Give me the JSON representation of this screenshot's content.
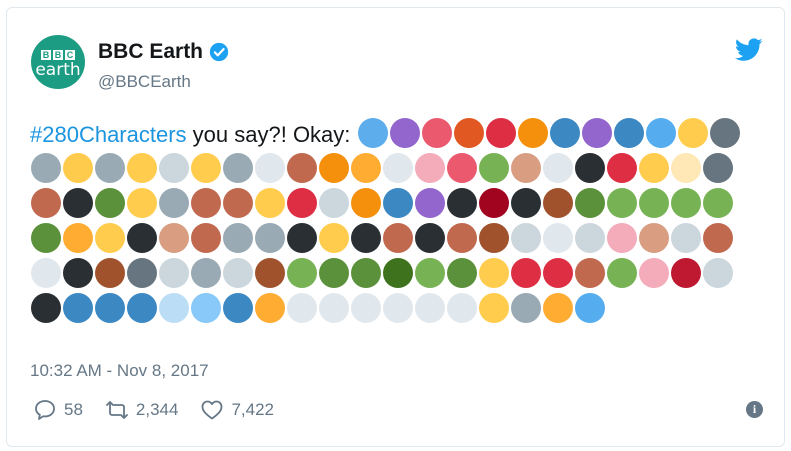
{
  "author": {
    "display_name": "BBC Earth",
    "handle": "@BBCEarth",
    "avatar": {
      "logo_letters": [
        "B",
        "B",
        "C"
      ],
      "logo_word": "earth",
      "color": "#1d9c84"
    },
    "verified_icon": "verified-badge-icon"
  },
  "platform_icon": "twitter-bird-icon",
  "tweet": {
    "hashtag": "#280Characters",
    "text": " you say?! Okay: ",
    "emojis": [
      {
        "name": "blue-heart",
        "color": "#5dadec"
      },
      {
        "name": "octopus",
        "color": "#9266cc"
      },
      {
        "name": "squid",
        "color": "#ea596e"
      },
      {
        "name": "shrimp",
        "color": "#e25822"
      },
      {
        "name": "crab",
        "color": "#dd2e44"
      },
      {
        "name": "blowfish",
        "color": "#f4900c"
      },
      {
        "name": "whale",
        "color": "#3b88c3"
      },
      {
        "name": "spouting-whale",
        "color": "#9266cc"
      },
      {
        "name": "dolphin",
        "color": "#3b88c3"
      },
      {
        "name": "fish",
        "color": "#55acee"
      },
      {
        "name": "tropical-fish",
        "color": "#ffcc4d"
      },
      {
        "name": "shark",
        "color": "#66757f"
      },
      {
        "name": "dog-face",
        "color": "#99aab5"
      },
      {
        "name": "cat-face",
        "color": "#ffcb4c"
      },
      {
        "name": "mouse-face",
        "color": "#99aab5"
      },
      {
        "name": "hamster-face",
        "color": "#ffcc4d"
      },
      {
        "name": "rabbit-face",
        "color": "#ccd6dd"
      },
      {
        "name": "tiger-face",
        "color": "#ffcc4d"
      },
      {
        "name": "koala",
        "color": "#99aab5"
      },
      {
        "name": "panda",
        "color": "#e1e8ed"
      },
      {
        "name": "bear",
        "color": "#c1694f"
      },
      {
        "name": "fox",
        "color": "#f4900c"
      },
      {
        "name": "lion",
        "color": "#ffac33"
      },
      {
        "name": "cow-face",
        "color": "#e1e8ed"
      },
      {
        "name": "pig-face",
        "color": "#f4abba"
      },
      {
        "name": "pig-nose",
        "color": "#ea596e"
      },
      {
        "name": "frog",
        "color": "#77b255"
      },
      {
        "name": "monkey-face",
        "color": "#d99e82"
      },
      {
        "name": "rooster",
        "color": "#e1e8ed"
      },
      {
        "name": "penguin",
        "color": "#292f33"
      },
      {
        "name": "bird",
        "color": "#dd2e44"
      },
      {
        "name": "baby-chick",
        "color": "#ffcc4d"
      },
      {
        "name": "hatching-chick",
        "color": "#ffe8b6"
      },
      {
        "name": "bat",
        "color": "#66757f"
      },
      {
        "name": "owl",
        "color": "#c1694f"
      },
      {
        "name": "eagle",
        "color": "#292f33"
      },
      {
        "name": "duck",
        "color": "#5c913b"
      },
      {
        "name": "front-chick",
        "color": "#ffcc4d"
      },
      {
        "name": "wolf",
        "color": "#99aab5"
      },
      {
        "name": "boar",
        "color": "#c1694f"
      },
      {
        "name": "horse-face",
        "color": "#c1694f"
      },
      {
        "name": "honeybee",
        "color": "#ffcc4d"
      },
      {
        "name": "lady-beetle",
        "color": "#dd2e44"
      },
      {
        "name": "shell",
        "color": "#ccd6dd"
      },
      {
        "name": "snail",
        "color": "#f4900c"
      },
      {
        "name": "butterfly",
        "color": "#3b88c3"
      },
      {
        "name": "caterpillar",
        "color": "#9266cc"
      },
      {
        "name": "ant",
        "color": "#292f33"
      },
      {
        "name": "cricket",
        "color": "#a0041e"
      },
      {
        "name": "spider",
        "color": "#292f33"
      },
      {
        "name": "scorpion",
        "color": "#a0522d"
      },
      {
        "name": "turtle",
        "color": "#5c913b"
      },
      {
        "name": "snake",
        "color": "#77b255"
      },
      {
        "name": "lizard",
        "color": "#77b255"
      },
      {
        "name": "t-rex",
        "color": "#77b255"
      },
      {
        "name": "sauropod",
        "color": "#77b255"
      },
      {
        "name": "crocodile",
        "color": "#5c913b"
      },
      {
        "name": "tiger",
        "color": "#ffac33"
      },
      {
        "name": "leopard",
        "color": "#ffcc4d"
      },
      {
        "name": "zebra",
        "color": "#292f33"
      },
      {
        "name": "dromedary",
        "color": "#d99e82"
      },
      {
        "name": "camel",
        "color": "#c1694f"
      },
      {
        "name": "rhinoceros",
        "color": "#99aab5"
      },
      {
        "name": "elephant",
        "color": "#99aab5"
      },
      {
        "name": "gorilla",
        "color": "#292f33"
      },
      {
        "name": "giraffe",
        "color": "#ffcc4d"
      },
      {
        "name": "water-buffalo",
        "color": "#292f33"
      },
      {
        "name": "ox",
        "color": "#c1694f"
      },
      {
        "name": "cow",
        "color": "#292f33"
      },
      {
        "name": "horse",
        "color": "#c1694f"
      },
      {
        "name": "deer",
        "color": "#a0522d"
      },
      {
        "name": "goat",
        "color": "#ccd6dd"
      },
      {
        "name": "ram",
        "color": "#e1e8ed"
      },
      {
        "name": "sheep",
        "color": "#ccd6dd"
      },
      {
        "name": "pig",
        "color": "#f4abba"
      },
      {
        "name": "dog",
        "color": "#d99e82"
      },
      {
        "name": "poodle",
        "color": "#ccd6dd"
      },
      {
        "name": "dog2",
        "color": "#c1694f"
      },
      {
        "name": "chicken",
        "color": "#e1e8ed"
      },
      {
        "name": "turkey",
        "color": "#292f33"
      },
      {
        "name": "chipmunk",
        "color": "#a0522d"
      },
      {
        "name": "rat",
        "color": "#66757f"
      },
      {
        "name": "mouse",
        "color": "#ccd6dd"
      },
      {
        "name": "rabbit",
        "color": "#99aab5"
      },
      {
        "name": "dove",
        "color": "#ccd6dd"
      },
      {
        "name": "hedgehog",
        "color": "#a0522d"
      },
      {
        "name": "seedling",
        "color": "#77b255"
      },
      {
        "name": "palm-tree",
        "color": "#5c913b"
      },
      {
        "name": "deciduous-tree",
        "color": "#5c913b"
      },
      {
        "name": "evergreen-tree",
        "color": "#3e721d"
      },
      {
        "name": "herb",
        "color": "#77b255"
      },
      {
        "name": "shamrock",
        "color": "#5c913b"
      },
      {
        "name": "sheaf-of-rice",
        "color": "#ffcc4d"
      },
      {
        "name": "mushroom",
        "color": "#dd2e44"
      },
      {
        "name": "maple-leaf",
        "color": "#dd2e44"
      },
      {
        "name": "fallen-leaf",
        "color": "#c1694f"
      },
      {
        "name": "leaf-fluttering",
        "color": "#77b255"
      },
      {
        "name": "tulip",
        "color": "#f4abba"
      },
      {
        "name": "rose",
        "color": "#be1931"
      },
      {
        "name": "full-moon-face",
        "color": "#ccd6dd"
      },
      {
        "name": "new-moon-face",
        "color": "#292f33"
      },
      {
        "name": "globe-africa",
        "color": "#3b88c3"
      },
      {
        "name": "globe-americas",
        "color": "#3b88c3"
      },
      {
        "name": "globe-asia",
        "color": "#3b88c3"
      },
      {
        "name": "wind",
        "color": "#bbddf5"
      },
      {
        "name": "snowflake",
        "color": "#88c9f9"
      },
      {
        "name": "water-wave",
        "color": "#3b88c3"
      },
      {
        "name": "sun",
        "color": "#ffac33"
      },
      {
        "name": "sun-rain-cloud",
        "color": "#e1e8ed"
      },
      {
        "name": "rain-cloud",
        "color": "#e1e8ed"
      },
      {
        "name": "lightning-cloud",
        "color": "#e1e8ed"
      },
      {
        "name": "rain-snow-cloud",
        "color": "#e1e8ed"
      },
      {
        "name": "snow-cloud",
        "color": "#e1e8ed"
      },
      {
        "name": "cloud",
        "color": "#e1e8ed"
      },
      {
        "name": "sun-behind-cloud",
        "color": "#ffcc4d"
      },
      {
        "name": "tornado",
        "color": "#99aab5"
      },
      {
        "name": "lightning",
        "color": "#ffac33"
      },
      {
        "name": "comet",
        "color": "#55acee"
      }
    ]
  },
  "timestamp": "10:32 AM - Nov 8, 2017",
  "actions": {
    "replies": "58",
    "retweets": "2,344",
    "likes": "7,422",
    "info_glyph": "i"
  },
  "colors": {
    "link": "#1b95e0",
    "secondary_text": "#657786",
    "twitter_blue": "#1da1f2"
  }
}
